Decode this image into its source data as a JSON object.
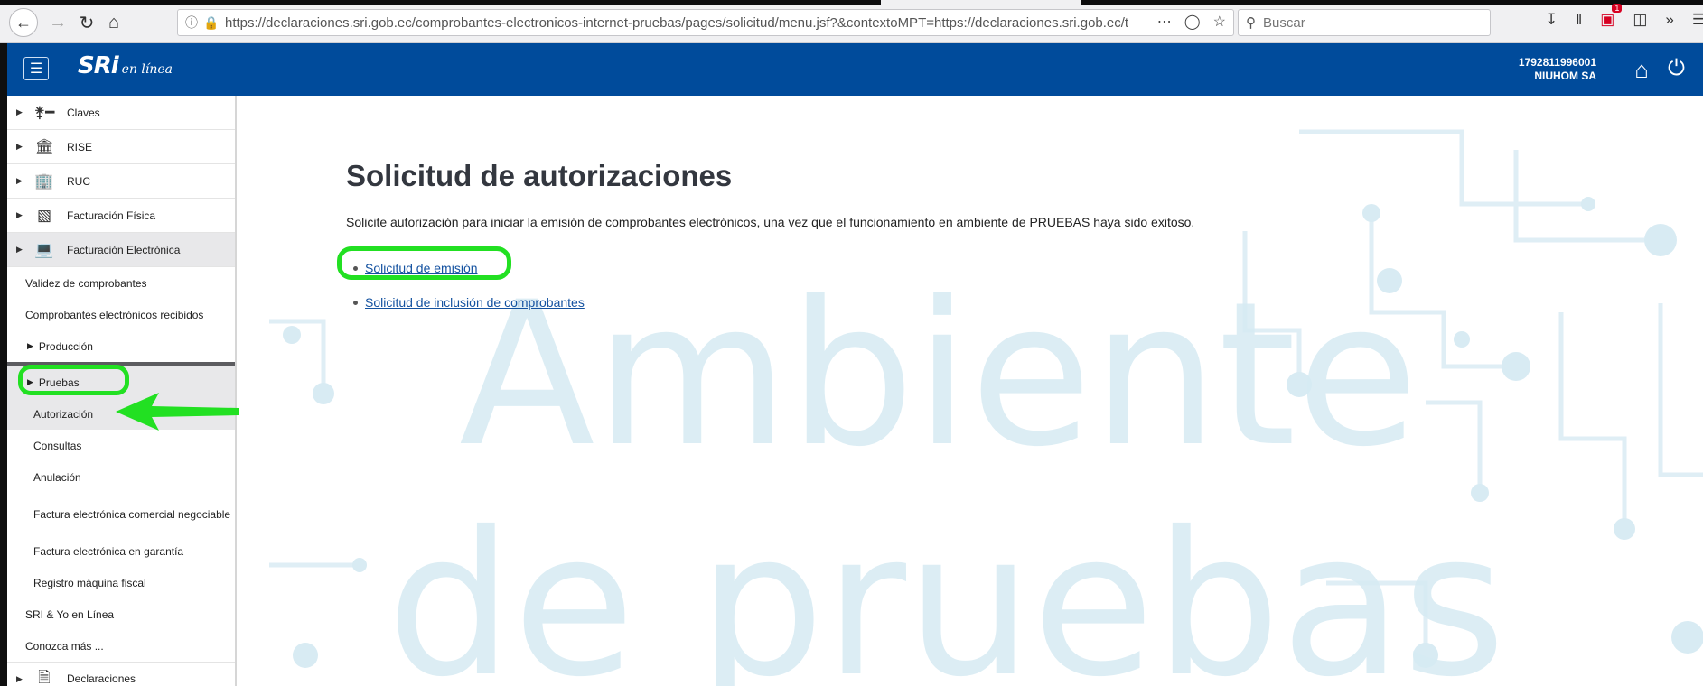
{
  "browser": {
    "url": "https://declaraciones.sri.gob.ec/comprobantes-electronicos-internet-pruebas/pages/solicitud/menu.jsf?&contextoMPT=https://declaraciones.sri.gob.ec/tup",
    "search_placeholder": "Buscar",
    "badge_count": "1",
    "icons": [
      "back-icon",
      "forward-icon",
      "reload-icon",
      "home-icon",
      "info-icon",
      "lock-icon",
      "more-icon",
      "pocket-icon",
      "bookmark-star-icon",
      "search-icon",
      "download-icon",
      "library-icon",
      "addon-icon",
      "sidebar-icon",
      "overflow-icon",
      "menu-icon"
    ]
  },
  "header": {
    "logo_main": "SRi",
    "logo_sub": "en línea",
    "ruc": "1792811996001",
    "company": "NIUHOM SA",
    "bg_color": "#004b9b"
  },
  "sidebar": {
    "top_items": [
      {
        "label": "Claves",
        "icon": "key-icon"
      },
      {
        "label": "RISE",
        "icon": "bank-icon"
      },
      {
        "label": "RUC",
        "icon": "building-icon"
      },
      {
        "label": "Facturación Física",
        "icon": "cash-register-icon"
      },
      {
        "label": "Facturación Electrónica",
        "icon": "laptop-icon"
      }
    ],
    "sub_items": {
      "validez": "Validez de comprobantes",
      "recibidos": "Comprobantes electrónicos recibidos",
      "produccion": "Producción",
      "pruebas": "Pruebas",
      "autorizacion": "Autorización",
      "consultas": "Consultas",
      "anulacion": "Anulación",
      "factura_comercial": "Factura electrónica comercial negociable",
      "factura_garantia": "Factura electrónica en garantía",
      "registro_maquina": "Registro máquina fiscal",
      "sri_yo": "SRI & Yo en Línea",
      "conozca": "Conozca más ..."
    },
    "bottom_item": {
      "label": "Declaraciones",
      "icon": "document-icon"
    }
  },
  "main": {
    "title": "Solicitud de autorizaciones",
    "intro": "Solicite autorización para iniciar la emisión de comprobantes electrónicos, una vez que el funcionamiento en ambiente de PRUEBAS haya sido exitoso.",
    "links": [
      "Solicitud de emisión",
      "Solicitud de inclusión de comprobantes"
    ],
    "watermark_line1": "Ambiente",
    "watermark_line2": "de pruebas"
  },
  "colors": {
    "highlight": "#22e022",
    "link": "#1452a0",
    "watermark": "#d6ebf3"
  }
}
